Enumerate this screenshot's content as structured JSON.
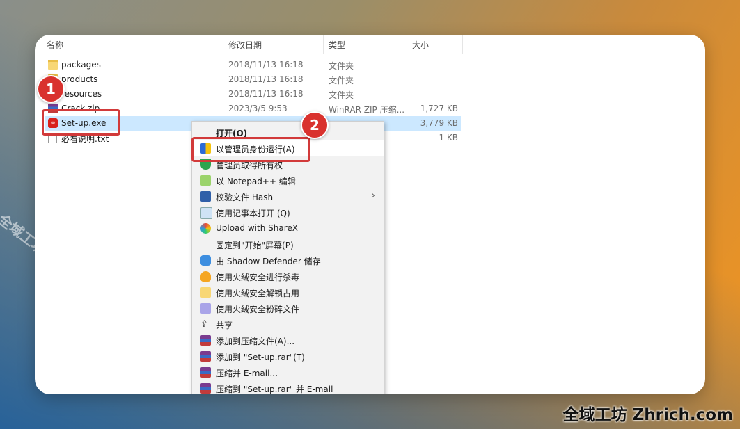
{
  "watermark": {
    "diagonal": "全域工坊 zhrich.com",
    "corner": "全域工坊 Zhrich.com"
  },
  "columns": {
    "name": "名称",
    "date": "修改日期",
    "type": "类型",
    "size": "大小"
  },
  "files": [
    {
      "name": "packages",
      "date": "2018/11/13 16:18",
      "type": "文件夹",
      "size": "",
      "icon": "folder-icon"
    },
    {
      "name": "products",
      "date": "2018/11/13 16:18",
      "type": "文件夹",
      "size": "",
      "icon": "folder-icon"
    },
    {
      "name": "resources",
      "date": "2018/11/13 16:18",
      "type": "文件夹",
      "size": "",
      "icon": "folder-icon"
    },
    {
      "name": "Crack.zip",
      "date": "2023/3/5 9:53",
      "type": "WinRAR ZIP 压缩...",
      "size": "1,727 KB",
      "icon": "winrar-zip-icon"
    },
    {
      "name": "Set-up.exe",
      "date": "",
      "type": "",
      "size": "3,779 KB",
      "icon": "adobe-installer-icon"
    },
    {
      "name": "必看说明.txt",
      "date": "",
      "type": "",
      "size": "1 KB",
      "icon": "text-file-icon"
    }
  ],
  "badges": {
    "step1": "1",
    "step2": "2"
  },
  "menu": {
    "items": [
      {
        "label": "打开(O)",
        "icon": ""
      },
      {
        "label": "以管理员身份运行(A)",
        "icon": "uac-shield-icon"
      },
      {
        "label": "管理员取得所有权",
        "icon": "green-shield-icon"
      },
      {
        "label": "以 Notepad++ 编辑",
        "icon": "notepadpp-icon"
      },
      {
        "label": "校验文件 Hash",
        "icon": "powershell-icon"
      },
      {
        "label": "使用记事本打开 (Q)",
        "icon": "notepad-icon"
      },
      {
        "label": "Upload with ShareX",
        "icon": "sharex-icon"
      },
      {
        "label": "固定到\"开始\"屏幕(P)",
        "icon": ""
      },
      {
        "label": "由 Shadow Defender 储存",
        "icon": "shadow-defender-icon"
      },
      {
        "label": "使用火绒安全进行杀毒",
        "icon": "huorong-icon"
      },
      {
        "label": "使用火绒安全解锁占用",
        "icon": "huorong-unlock-icon"
      },
      {
        "label": "使用火绒安全粉碎文件",
        "icon": "huorong-shred-icon"
      },
      {
        "label": "共享",
        "icon": "share-icon"
      },
      {
        "label": "添加到压缩文件(A)...",
        "icon": "winrar-icon"
      },
      {
        "label": "添加到 \"Set-up.rar\"(T)",
        "icon": "winrar-icon"
      },
      {
        "label": "压缩并 E-mail...",
        "icon": "winrar-icon"
      },
      {
        "label": "压缩到 \"Set-up.rar\" 并 E-mail",
        "icon": "winrar-icon"
      }
    ]
  },
  "colors": {
    "selected_row": "#cce8ff",
    "highlight_box": "#d23a3a",
    "badge": "#d9322e"
  }
}
